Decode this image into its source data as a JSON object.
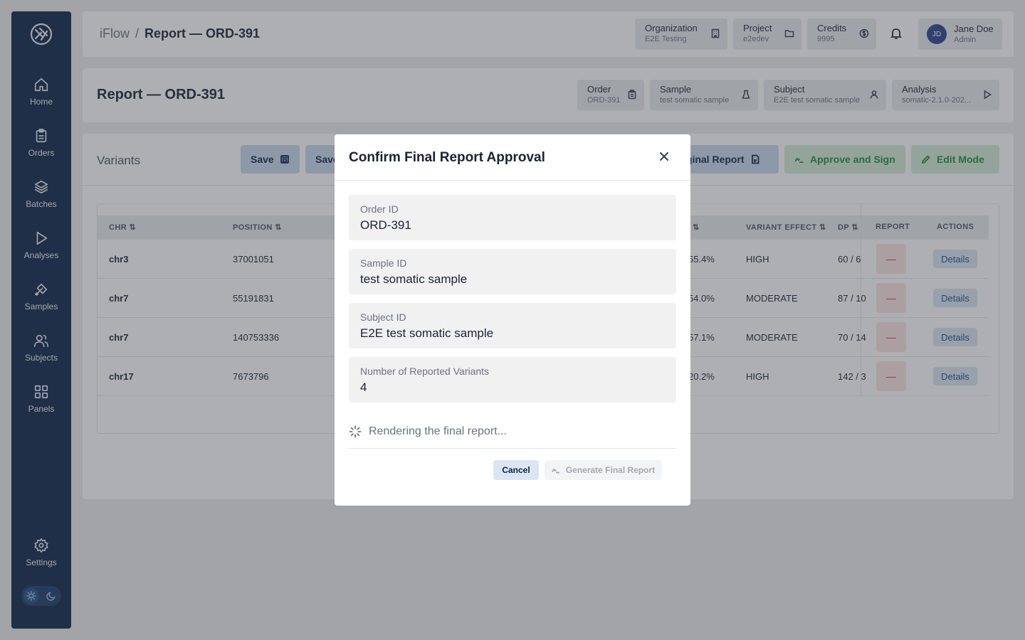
{
  "breadcrumb": {
    "root": "iFlow",
    "separator": "/",
    "current": "Report — ORD-391"
  },
  "sidebar": {
    "items": [
      {
        "label": "Home",
        "icon": "home-icon"
      },
      {
        "label": "Orders",
        "icon": "clipboard-icon"
      },
      {
        "label": "Batches",
        "icon": "layers-icon"
      },
      {
        "label": "Analyses",
        "icon": "play-icon"
      },
      {
        "label": "Samples",
        "icon": "flask-icon"
      },
      {
        "label": "Subjects",
        "icon": "users-icon"
      },
      {
        "label": "Panels",
        "icon": "grid-icon"
      },
      {
        "label": "Settings",
        "icon": "gear-icon"
      }
    ]
  },
  "header": {
    "organization": {
      "title": "Organization",
      "value": "E2E Testing"
    },
    "project": {
      "title": "Project",
      "value": "e2edev"
    },
    "credits": {
      "title": "Credits",
      "value": "9995"
    },
    "user": {
      "initials": "JD",
      "name": "Jane Doe",
      "role": "Admin"
    }
  },
  "report": {
    "title": "Report — ORD-391",
    "meta": {
      "order": {
        "title": "Order",
        "value": "ORD-391"
      },
      "sample": {
        "title": "Sample",
        "value": "test somatic sample"
      },
      "subject": {
        "title": "Subject",
        "value": "E2E test somatic sample"
      },
      "analysis": {
        "title": "Analysis",
        "value": "somatic-2.1.0-202..."
      }
    }
  },
  "variants": {
    "title": "Variants",
    "buttons": {
      "save": "Save",
      "save2": "Save",
      "original_report": "iginal Report",
      "approve": "Approve and Sign",
      "edit": "Edit Mode"
    },
    "columns": {
      "chr": "CHR ⇅",
      "position": "POSITION ⇅",
      "vaf_sort": "⇅",
      "effect": "VARIANT EFFECT ⇅",
      "dp": "DP ⇅",
      "report": "REPORT",
      "actions": "ACTIONS"
    },
    "rows": [
      {
        "chr": "chr3",
        "position": "37001051",
        "vaf": "55.4%",
        "effect": "HIGH",
        "dp": "60 / 6",
        "report": "—",
        "action": "Details"
      },
      {
        "chr": "chr7",
        "position": "55191831",
        "vaf": "54.0%",
        "effect": "MODERATE",
        "dp": "87 / 10",
        "report": "—",
        "action": "Details"
      },
      {
        "chr": "chr7",
        "position": "140753336",
        "vaf": "57.1%",
        "effect": "MODERATE",
        "dp": "70 / 14",
        "report": "—",
        "action": "Details"
      },
      {
        "chr": "chr17",
        "position": "7673796",
        "vaf": "20.2%",
        "effect": "HIGH",
        "dp": "142 / 3",
        "report": "—",
        "action": "Details"
      }
    ]
  },
  "modal": {
    "title": "Confirm Final Report Approval",
    "fields": [
      {
        "label": "Order ID",
        "value": "ORD-391"
      },
      {
        "label": "Sample ID",
        "value": "test somatic sample"
      },
      {
        "label": "Subject ID",
        "value": "E2E test somatic sample"
      },
      {
        "label": "Number of Reported Variants",
        "value": "4"
      }
    ],
    "loading_text": "Rendering the final report...",
    "cancel_label": "Cancel",
    "generate_label": "Generate Final Report"
  },
  "colors": {
    "sidebar_bg": "#0b2447",
    "accent_blue": "#c8d9ef",
    "accent_green": "#1f8a3c",
    "report_red": "#c23b3b"
  }
}
